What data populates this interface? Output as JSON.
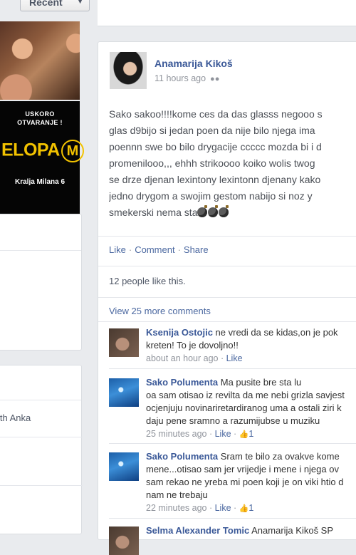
{
  "topbar": {
    "recent_label": "Recent",
    "caret": "▼"
  },
  "left_ads": {
    "coming_line1": "USKORO",
    "coming_line2": "OTVARANJE !",
    "logo_text": "ELOPA",
    "logo_m": "M",
    "address": "Kralja Milana 6"
  },
  "sidebar_friend_text": "ith Anka",
  "post": {
    "author": "Anamarija Kikoš",
    "time": "11 hours ago",
    "audience_icon": "friends-icon",
    "text_lines": [
      "Sako sakoo!!!!kome ces da das glasss negooo s",
      "glas d9bijo si jedan poen da nije bilo njega ima",
      "poennn swe bo bilo drygacije ccccc mozda bi i d",
      "promeniloоо,,, ehhh strikoooo koiko wolis twog",
      "se drze djenan lexintony lexintonn djenany kako",
      "jedno drygom a swojim gestom nabijo si noz y",
      "smekerski nema sta"
    ],
    "actions": {
      "like": "Like",
      "comment": "Comment",
      "share": "Share"
    },
    "likes_text": "12 people like this.",
    "view_more": "View 25 more comments"
  },
  "comments": [
    {
      "name": "Ksenija Ostojic",
      "lines": [
        "ne vredi da se kidas,on je pok",
        "kreten! To je dovoljno!!"
      ],
      "time": "about an hour ago",
      "like": "Like",
      "likes_count": ""
    },
    {
      "name": "Sako Polumenta",
      "lines": [
        "Ma pusite bre          sta lu",
        "oa sam otisao iz revilta da me nebi grizla savjest",
        "ocjenjuju novinariretardiranog uma a ostali ziri k",
        "daju pene sramno a razumijubse u muziku"
      ],
      "time": "25 minutes ago",
      "like": "Like",
      "likes_count": "1"
    },
    {
      "name": "Sako Polumenta",
      "lines": [
        "Sram te bilo za ovakve kome",
        "mene...otisao sam jer vrijedje i mene i njega ov",
        "sam rekao ne yreba mi poen koji je on viki htio d",
        "nam ne trebaju"
      ],
      "time": "22 minutes ago",
      "like": "Like",
      "likes_count": "1"
    },
    {
      "name": "Selma Alexander Tomic",
      "lines": [
        "Anamarija Kikoš SP"
      ],
      "time": "",
      "like": "",
      "likes_count": ""
    }
  ]
}
